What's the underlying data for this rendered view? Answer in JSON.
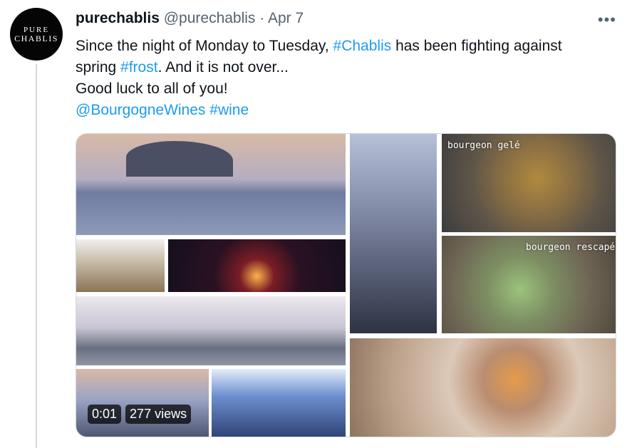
{
  "tweet": {
    "author_name": "purechablis",
    "handle": "@purechablis",
    "separator": "·",
    "date": "Apr 7",
    "more_icon": "more-horizontal-icon",
    "avatar": {
      "line1": "PURE",
      "line2": "CHABLIS"
    },
    "text": {
      "line1_a": "Since the night of Monday to Tuesday, ",
      "hashtag_chablis": "#Chablis",
      "line1_b": " has been fighting against",
      "line2_a": "spring ",
      "hashtag_frost": "#frost",
      "line2_b": ". And it is not over...",
      "line3": "Good luck to all of you!",
      "mention": "@BourgogneWines",
      "space": " ",
      "hashtag_wine": "#wine"
    },
    "colors": {
      "link": "#1d9bf0",
      "muted": "#536471"
    }
  },
  "video": {
    "caption_frozen": "bourgeon gelé",
    "caption_escaped": "bourgeon rescapé",
    "time": "0:01",
    "views": "277 views"
  }
}
